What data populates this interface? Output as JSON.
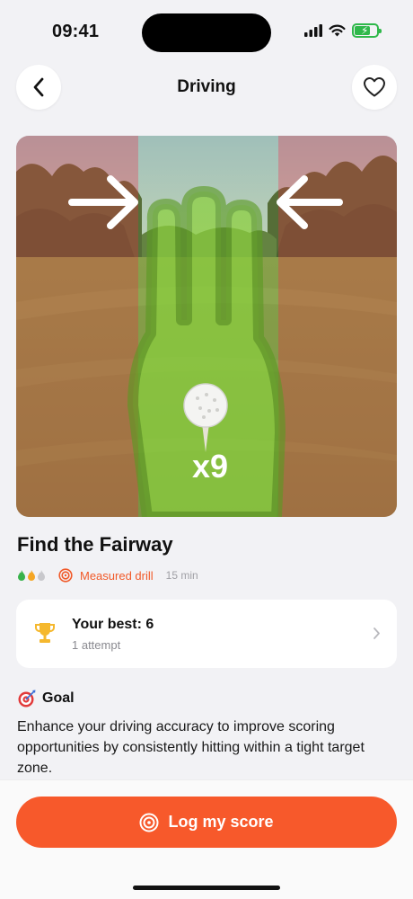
{
  "status_bar": {
    "time": "09:41"
  },
  "nav": {
    "title": "Driving"
  },
  "hero": {
    "multiplier": "x9"
  },
  "drill": {
    "title": "Find the Fairway",
    "difficulty_level": 2,
    "difficulty_max": 3,
    "type_label": "Measured drill",
    "duration": "15 min"
  },
  "best": {
    "label": "Your best: 6",
    "attempts": "1 attempt"
  },
  "goal": {
    "heading": "Goal",
    "text": "Enhance your driving accuracy to improve scoring opportunities by consistently hitting within a tight target zone."
  },
  "cta": {
    "label": "Log my score"
  },
  "colors": {
    "accent": "#f7592b",
    "type_text": "#f15a29",
    "flame_active": "#f5a623",
    "battery": "#2fb84a"
  }
}
